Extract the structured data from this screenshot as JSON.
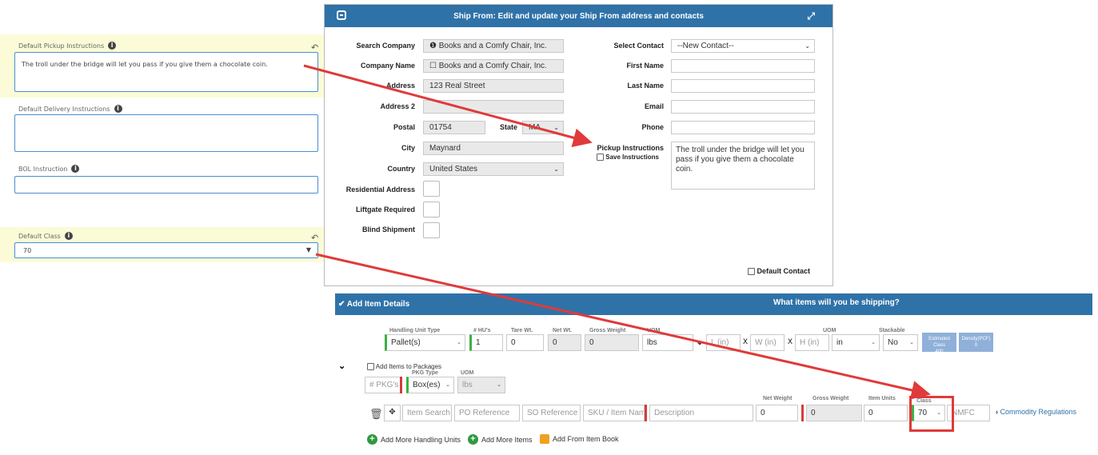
{
  "left_panel": {
    "pickup": {
      "label": "Default Pickup Instructions",
      "value": "The troll under the bridge will let you pass if you give them a chocolate coin."
    },
    "delivery": {
      "label": "Default Delivery Instructions",
      "value": ""
    },
    "bol": {
      "label": "BOL Instruction",
      "value": ""
    },
    "class": {
      "label": "Default Class",
      "value": "70"
    }
  },
  "modal": {
    "title": "Ship From: Edit and update your Ship From address and contacts",
    "fields": {
      "search_company": {
        "label": "Search Company",
        "value": "Books and a Comfy Chair, Inc."
      },
      "company_name": {
        "label": "Company Name",
        "value": "Books and a Comfy Chair, Inc."
      },
      "address": {
        "label": "Address",
        "value": "123 Real Street"
      },
      "address2": {
        "label": "Address 2",
        "value": ""
      },
      "postal": {
        "label": "Postal",
        "value": "01754"
      },
      "state": {
        "label": "State",
        "value": "MA"
      },
      "city": {
        "label": "City",
        "value": "Maynard"
      },
      "country": {
        "label": "Country",
        "value": "United States"
      },
      "residential": {
        "label": "Residential Address"
      },
      "liftgate": {
        "label": "Liftgate Required"
      },
      "blind": {
        "label": "Blind Shipment"
      },
      "select_contact": {
        "label": "Select Contact",
        "value": "--New Contact--"
      },
      "first_name": {
        "label": "First Name",
        "value": ""
      },
      "last_name": {
        "label": "Last Name",
        "value": ""
      },
      "email": {
        "label": "Email",
        "value": ""
      },
      "phone": {
        "label": "Phone",
        "value": ""
      },
      "pickup_instructions": {
        "label": "Pickup Instructions",
        "value": "The troll under the bridge will let you pass if you give them a chocolate coin."
      },
      "save_instructions": "Save Instructions",
      "default_contact": "Default Contact"
    }
  },
  "items": {
    "header_left": "Add Item Details",
    "header_center": "What items will you be shipping?",
    "col_labels": {
      "handling_unit_type": "Handling Unit Type",
      "hus": "# HU's",
      "tare": "Tare Wt.",
      "net": "Net Wt.",
      "gross": "Gross Weight",
      "uom": "UOM",
      "uom2": "UOM",
      "stackable": "Stackable"
    },
    "row1": {
      "handling_unit_type": "Pallet(s)",
      "hus": "1",
      "tare": "0",
      "net": "0",
      "gross": "0",
      "uom": "lbs",
      "l": "L (in)",
      "w": "W (in)",
      "h": "H (in)",
      "x": "X",
      "dim_uom": "in",
      "stackable": "No",
      "est_class_label": "Estimated Class",
      "est_class": "400",
      "density_label": "Density(PCF)",
      "density": "0"
    },
    "add_to_packages": "Add Items to Packages",
    "pkg_labels": {
      "pkg_type": "PKG Type",
      "uom": "UOM"
    },
    "pkg_row": {
      "pkgs": "# PKG's",
      "pkg_type": "Box(es)",
      "uom": "lbs"
    },
    "row2_labels": {
      "net_weight": "Net Weight",
      "gross_weight": "Gross Weight",
      "item_units": "Item Units",
      "class": "Class"
    },
    "row2": {
      "item_search": "Item Search",
      "po": "PO Reference",
      "so": "SO Reference",
      "sku": "SKU / Item Nam",
      "desc": "Description",
      "net": "0",
      "gross": "0",
      "units": "0",
      "class": "70",
      "nmfc": "NMFC",
      "commodity": "Commodity Regulations"
    },
    "actions": {
      "add_hu": "Add More Handling Units",
      "add_items": "Add More Items",
      "add_book": "Add From Item Book"
    }
  },
  "colors": {
    "header_blue": "#2f72a8",
    "highlight": "#fbfbd8",
    "annotation_red": "#e03a3a",
    "green": "#3cb043"
  }
}
